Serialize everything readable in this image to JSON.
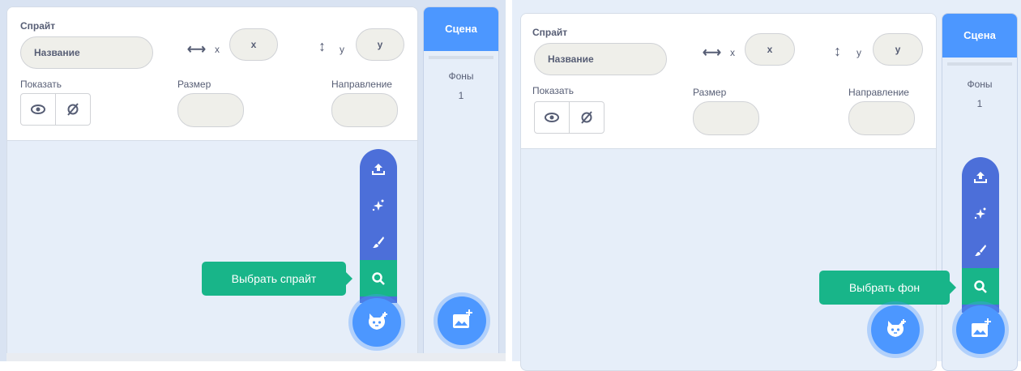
{
  "left": {
    "sprite_label": "Спрайт",
    "name_placeholder": "Название",
    "x_label": "x",
    "x_value": "x",
    "y_label": "y",
    "y_value": "y",
    "show_label": "Показать",
    "size_label": "Размер",
    "direction_label": "Направление",
    "stage_title": "Сцена",
    "backdrops_label": "Фоны",
    "backdrops_count": "1",
    "tooltip": "Выбрать спрайт"
  },
  "right": {
    "sprite_label": "Спрайт",
    "name_placeholder": "Название",
    "x_label": "x",
    "x_value": "x",
    "y_label": "y",
    "y_value": "y",
    "show_label": "Показать",
    "size_label": "Размер",
    "direction_label": "Направление",
    "stage_title": "Сцена",
    "backdrops_label": "Фоны",
    "backdrops_count": "1",
    "tooltip": "Выбрать фон"
  },
  "colors": {
    "accent_blue": "#4c97ff",
    "menu_blue": "#4c6fd9",
    "active_green": "#18b589",
    "pane_bg": "#e6eef9",
    "text_gray": "#575e75"
  },
  "icons": [
    "upload-icon",
    "surprise-sparkle-icon",
    "paint-brush-icon",
    "search-icon",
    "add-sprite-cat-icon",
    "add-backdrop-image-icon",
    "eye-icon",
    "eye-off-icon",
    "horizontal-arrow-icon",
    "vertical-arrow-icon"
  ]
}
